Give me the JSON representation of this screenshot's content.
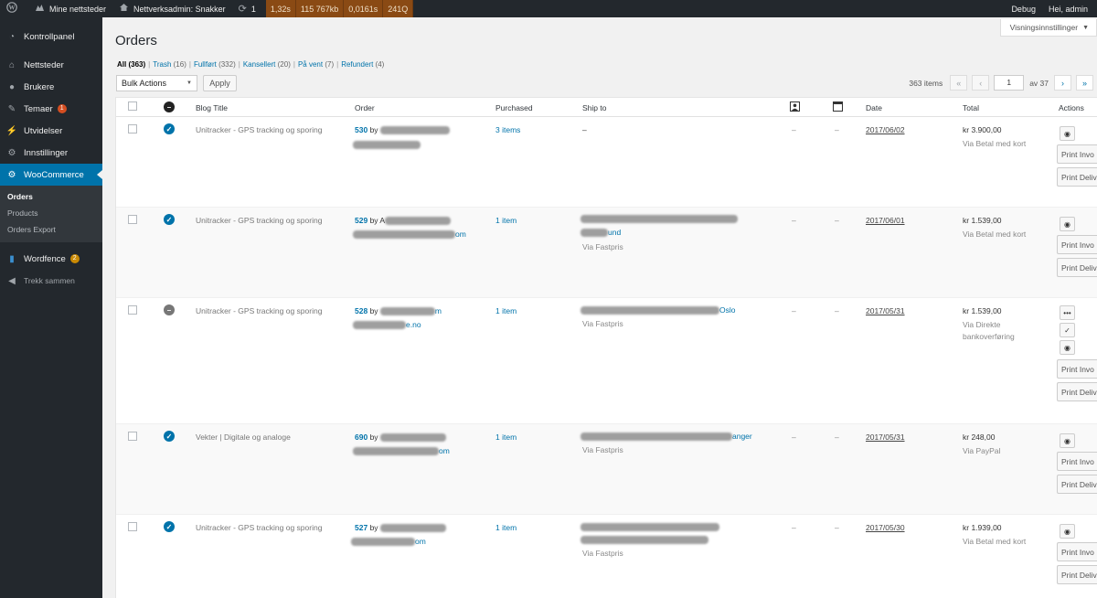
{
  "adminbar": {
    "sites": "Mine nettsteder",
    "network": "Nettverksadmin: Snakker",
    "updates": "1",
    "perf": [
      "1,32s",
      "115 767kb",
      "0,0161s",
      "241Q"
    ],
    "debug": "Debug",
    "greeting": "Hei, admin"
  },
  "sidebar": {
    "items": [
      {
        "label": "Kontrollpanel",
        "icon": "dashboard-icon"
      },
      {
        "label": "Nettsteder",
        "icon": "sites-icon"
      },
      {
        "label": "Brukere",
        "icon": "users-icon"
      },
      {
        "label": "Temaer",
        "icon": "themes-icon",
        "badge": "1"
      },
      {
        "label": "Utvidelser",
        "icon": "plugins-icon"
      },
      {
        "label": "Innstillinger",
        "icon": "settings-icon"
      },
      {
        "label": "WooCommerce",
        "icon": "woocommerce-icon"
      }
    ],
    "submenu": [
      "Orders",
      "Products",
      "Orders Export"
    ],
    "wordfence": {
      "label": "Wordfence",
      "badge": "2"
    },
    "collapse": "Trekk sammen"
  },
  "screen_options": "Visningsinnstillinger",
  "page_title": "Orders",
  "filters": [
    {
      "label": "All",
      "count": "(363)"
    },
    {
      "label": "Trash",
      "count": "(16)"
    },
    {
      "label": "Fullført",
      "count": "(332)"
    },
    {
      "label": "Kansellert",
      "count": "(20)"
    },
    {
      "label": "På vent",
      "count": "(7)"
    },
    {
      "label": "Refundert",
      "count": "(4)"
    }
  ],
  "bulk_actions": "Bulk Actions",
  "apply": "Apply",
  "pagination": {
    "items": "363 items",
    "first": "«",
    "prev": "‹",
    "current": "1",
    "of": "av 37",
    "next": "›",
    "last": "»"
  },
  "columns": {
    "blog": "Blog Title",
    "order": "Order",
    "purchased": "Purchased",
    "ship": "Ship to",
    "date": "Date",
    "total": "Total",
    "actions": "Actions"
  },
  "rows": [
    {
      "blog": "Unitracker - GPS tracking og sporing",
      "num": "530",
      "by": "by",
      "purchased": "3 items",
      "ship": "–",
      "ship_via": "",
      "ship_end": "",
      "ship2_end": "",
      "date": "2017/06/02",
      "total": "kr 3.900,00",
      "payment": "Via Betal med kort",
      "payment2": "",
      "status": "done",
      "email_end": ""
    },
    {
      "blog": "Unitracker - GPS tracking og sporing",
      "num": "529",
      "by": "by A",
      "purchased": "1 item",
      "ship": "",
      "ship_via": "Via Fastpris",
      "ship_end": "",
      "ship2_end": "und",
      "date": "2017/06/01",
      "total": "kr 1.539,00",
      "payment": "Via Betal med kort",
      "payment2": "",
      "status": "done",
      "email_end": "om"
    },
    {
      "blog": "Unitracker - GPS tracking og sporing",
      "num": "528",
      "by": "by",
      "purchased": "1 item",
      "ship": "",
      "ship_via": "Via Fastpris",
      "ship_end": "Oslo",
      "ship2_end": "",
      "date": "2017/05/31",
      "total": "kr 1.539,00",
      "payment": "Via Direkte",
      "payment2": "bankoverføring",
      "status": "cancel",
      "email_end": "e.no",
      "name_end": "m"
    },
    {
      "blog": "Vekter | Digitale og analoge",
      "num": "690",
      "by": "by",
      "purchased": "1 item",
      "ship": "",
      "ship_via": "Via Fastpris",
      "ship_end": "anger",
      "ship2_end": "",
      "date": "2017/05/31",
      "total": "kr 248,00",
      "payment": "Via PayPal",
      "payment2": "",
      "status": "done",
      "email_end": "om"
    },
    {
      "blog": "Unitracker - GPS tracking og sporing",
      "num": "527",
      "by": "by",
      "purchased": "1 item",
      "ship": "",
      "ship_via": "Via Fastpris",
      "ship_end": "",
      "ship2_end": "",
      "date": "2017/05/30",
      "total": "kr 1.939,00",
      "payment": "Via Betal med kort",
      "payment2": "",
      "status": "done",
      "email_end": "om"
    }
  ],
  "action_labels": {
    "print_invoice": "Print Invo",
    "print_delivery": "Print Deliv"
  },
  "colors": {
    "sidebar": "#23282d",
    "accent": "#0073aa",
    "perf": "#8a4a14"
  }
}
